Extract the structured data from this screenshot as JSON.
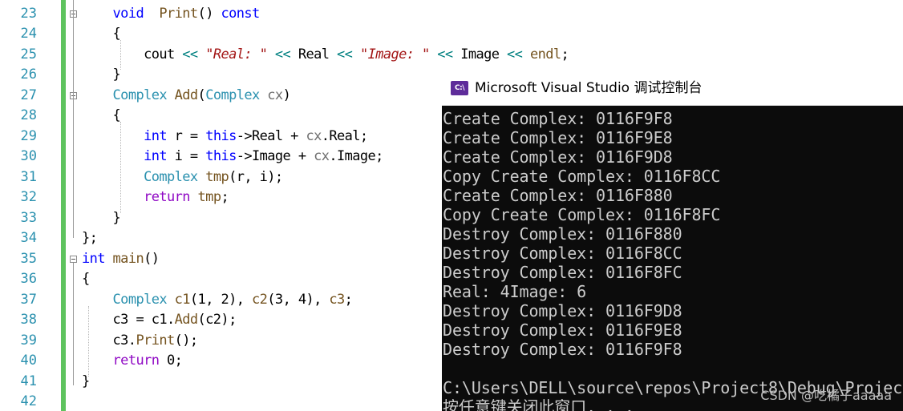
{
  "editor": {
    "line_numbers": [
      "23",
      "24",
      "25",
      "26",
      "27",
      "28",
      "29",
      "30",
      "31",
      "32",
      "33",
      "34",
      "35",
      "36",
      "37",
      "38",
      "39",
      "40",
      "41",
      "42"
    ],
    "lines": [
      [
        {
          "t": "    "
        },
        {
          "t": "void",
          "c": "kw"
        },
        {
          "t": "  "
        },
        {
          "t": "Print",
          "c": "fn"
        },
        {
          "t": "() "
        },
        {
          "t": "const",
          "c": "kw"
        }
      ],
      [
        {
          "t": "    {"
        }
      ],
      [
        {
          "t": "        cout "
        },
        {
          "t": "<<",
          "c": "op"
        },
        {
          "t": " "
        },
        {
          "t": "\"Real: \"",
          "c": "str"
        },
        {
          "t": " "
        },
        {
          "t": "<<",
          "c": "op"
        },
        {
          "t": " Real "
        },
        {
          "t": "<<",
          "c": "op"
        },
        {
          "t": " "
        },
        {
          "t": "\"Image: \"",
          "c": "str"
        },
        {
          "t": " "
        },
        {
          "t": "<<",
          "c": "op"
        },
        {
          "t": " Image "
        },
        {
          "t": "<<",
          "c": "op"
        },
        {
          "t": " "
        },
        {
          "t": "endl",
          "c": "fn"
        },
        {
          "t": ";"
        }
      ],
      [
        {
          "t": "    }"
        }
      ],
      [
        {
          "t": "    "
        },
        {
          "t": "Complex",
          "c": "ty"
        },
        {
          "t": " "
        },
        {
          "t": "Add",
          "c": "fn"
        },
        {
          "t": "("
        },
        {
          "t": "Complex",
          "c": "ty"
        },
        {
          "t": " "
        },
        {
          "t": "cx",
          "c": "mb"
        },
        {
          "t": ")"
        }
      ],
      [
        {
          "t": "    {"
        }
      ],
      [
        {
          "t": "        "
        },
        {
          "t": "int",
          "c": "kw"
        },
        {
          "t": " r = "
        },
        {
          "t": "this",
          "c": "kw"
        },
        {
          "t": "->Real + "
        },
        {
          "t": "cx",
          "c": "mb"
        },
        {
          "t": ".Real;"
        }
      ],
      [
        {
          "t": "        "
        },
        {
          "t": "int",
          "c": "kw"
        },
        {
          "t": " i = "
        },
        {
          "t": "this",
          "c": "kw"
        },
        {
          "t": "->Image + "
        },
        {
          "t": "cx",
          "c": "mb"
        },
        {
          "t": ".Image;"
        }
      ],
      [
        {
          "t": "        "
        },
        {
          "t": "Complex",
          "c": "ty"
        },
        {
          "t": " "
        },
        {
          "t": "tmp",
          "c": "fn"
        },
        {
          "t": "(r, i);"
        }
      ],
      [
        {
          "t": "        "
        },
        {
          "t": "return",
          "c": "ct"
        },
        {
          "t": " "
        },
        {
          "t": "tmp",
          "c": "fn"
        },
        {
          "t": ";"
        }
      ],
      [
        {
          "t": "    }"
        }
      ],
      [
        {
          "t": "};"
        }
      ],
      [
        {
          "t": "int",
          "c": "kw"
        },
        {
          "t": " "
        },
        {
          "t": "main",
          "c": "fn"
        },
        {
          "t": "()"
        }
      ],
      [
        {
          "t": "{"
        }
      ],
      [
        {
          "t": "    "
        },
        {
          "t": "Complex",
          "c": "ty"
        },
        {
          "t": " "
        },
        {
          "t": "c1",
          "c": "fn"
        },
        {
          "t": "(1, 2), "
        },
        {
          "t": "c2",
          "c": "fn"
        },
        {
          "t": "(3, 4), "
        },
        {
          "t": "c3",
          "c": "fn"
        },
        {
          "t": ";"
        }
      ],
      [
        {
          "t": "    c3 = c1."
        },
        {
          "t": "Add",
          "c": "fn"
        },
        {
          "t": "(c2);"
        }
      ],
      [
        {
          "t": "    c3."
        },
        {
          "t": "Print",
          "c": "fn"
        },
        {
          "t": "();"
        }
      ],
      [
        {
          "t": "    "
        },
        {
          "t": "return",
          "c": "ct"
        },
        {
          "t": " 0;"
        }
      ],
      [
        {
          "t": "}"
        }
      ],
      [
        {
          "t": ""
        }
      ]
    ]
  },
  "console": {
    "title": "Microsoft Visual Studio 调试控制台",
    "icon_label": "C:\\",
    "icon": "console-app-icon",
    "lines": [
      "Create Complex: 0116F9F8",
      "Create Complex: 0116F9E8",
      "Create Complex: 0116F9D8",
      "Copy Create Complex: 0116F8CC",
      "Create Complex: 0116F880",
      "Copy Create Complex: 0116F8FC",
      "Destroy Complex: 0116F880",
      "Destroy Complex: 0116F8CC",
      "Destroy Complex: 0116F8FC",
      "Real: 4Image: 6",
      "Destroy Complex: 0116F9D8",
      "Destroy Complex: 0116F9E8",
      "Destroy Complex: 0116F9F8",
      "",
      "C:\\Users\\DELL\\source\\repos\\Project8\\Debug\\Projec",
      "按任意键关闭此窗口. . ."
    ]
  },
  "watermark": "CSDN @吃橘子aaaaa",
  "colors": {
    "keyword": "#0000ff",
    "type": "#2b91af",
    "string": "#a31515",
    "operator": "#008080",
    "function": "#74531f",
    "control": "#8f08c4",
    "change_bar": "#5ec35e",
    "console_bg": "#0c0c0c",
    "console_text": "#cccccc"
  }
}
